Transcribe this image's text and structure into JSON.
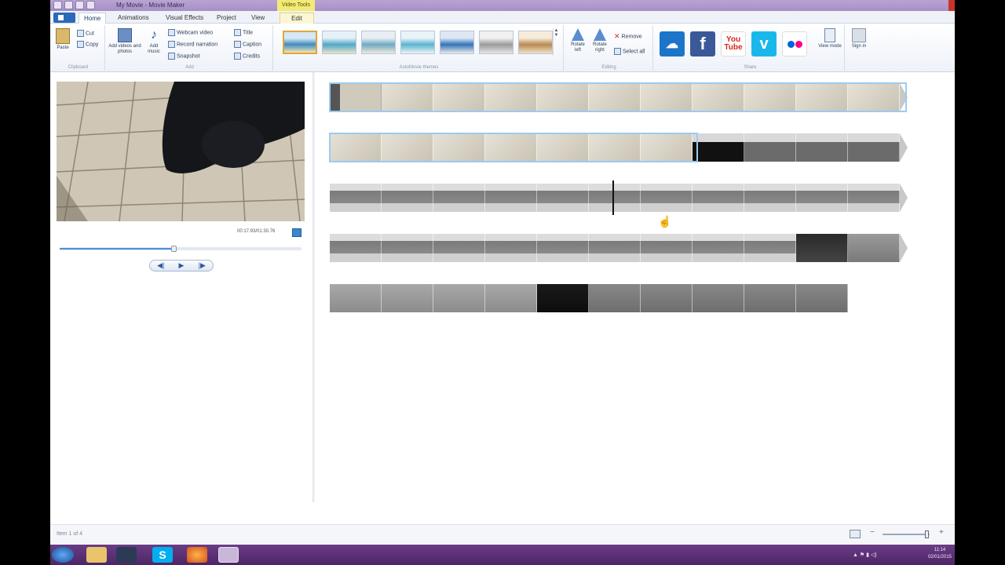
{
  "window": {
    "title": "My Movie - Movie Maker",
    "context_tab": "Video Tools"
  },
  "tabs": [
    "Home",
    "Animations",
    "Visual Effects",
    "Project",
    "View",
    "Edit"
  ],
  "ribbon": {
    "clipboard": {
      "paste": "Paste",
      "cut": "Cut",
      "copy": "Copy",
      "group": "Clipboard"
    },
    "add": {
      "add_videos": "Add videos and photos",
      "add_music": "Add music",
      "webcam": "Webcam video",
      "narration": "Record narration",
      "snapshot": "Snapshot",
      "title": "Title",
      "caption": "Caption",
      "credits": "Credits",
      "group": "Add"
    },
    "themes_group": "AutoMovie themes",
    "editing": {
      "rotate_left": "Rotate left",
      "rotate_right": "Rotate right",
      "remove": "Remove",
      "select_all": "Select all",
      "group": "Editing"
    },
    "share": {
      "view_mode": "View mode",
      "group": "Share",
      "sign_in": "Sign in"
    }
  },
  "player": {
    "time": "00:17.93/01:30.76",
    "progress": 0.47
  },
  "status": {
    "text": "Item 1 of 4"
  },
  "taskbar": {
    "time": "11:14",
    "date": "02/01/2015"
  },
  "colors": {
    "accent": "#2a6ab8",
    "taskbar": "#5a2e74",
    "selection": "#9ccbf0"
  }
}
